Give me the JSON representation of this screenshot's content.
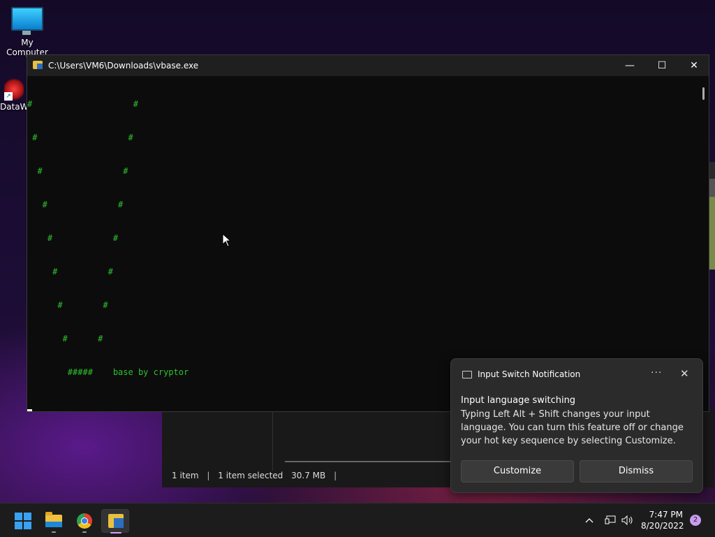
{
  "desktop": {
    "icons": [
      {
        "label": "My Computer",
        "icon": "monitor-icon"
      },
      {
        "label": "DataW",
        "icon": "datawrapper-shortcut-icon"
      }
    ]
  },
  "explorer": {
    "status_items": "1 item",
    "status_selected": "1 item selected",
    "status_size": "30.7 MB",
    "sep": "|"
  },
  "console": {
    "title": "C:\\Users\\VM6\\Downloads\\vbase.exe",
    "icon": "console-app-icon",
    "controls": {
      "minimize": "—",
      "maximize": "☐",
      "close": "✕"
    },
    "lines": [
      "#                    #",
      " #                  #",
      "  #                #",
      "   #              #",
      "    #            #",
      "     #          #",
      "      #        #",
      "       #      #",
      "        #####    base by cryptor"
    ]
  },
  "notification": {
    "header": "Input Switch Notification",
    "more": "···",
    "close": "✕",
    "heading": "Input language switching",
    "body": "Typing Left Alt + Shift changes your input language. You can turn this feature off or change your hot key sequence by selecting Customize.",
    "customize_label": "Customize",
    "dismiss_label": "Dismiss"
  },
  "taskbar": {
    "apps": [
      "start-icon",
      "file-explorer-icon",
      "chrome-icon",
      "console-app-icon"
    ],
    "tray": {
      "chevron": "^",
      "network": "🖧",
      "volume": "🔊"
    },
    "time": "7:47 PM",
    "date": "8/20/2022",
    "notification_count": "2"
  }
}
